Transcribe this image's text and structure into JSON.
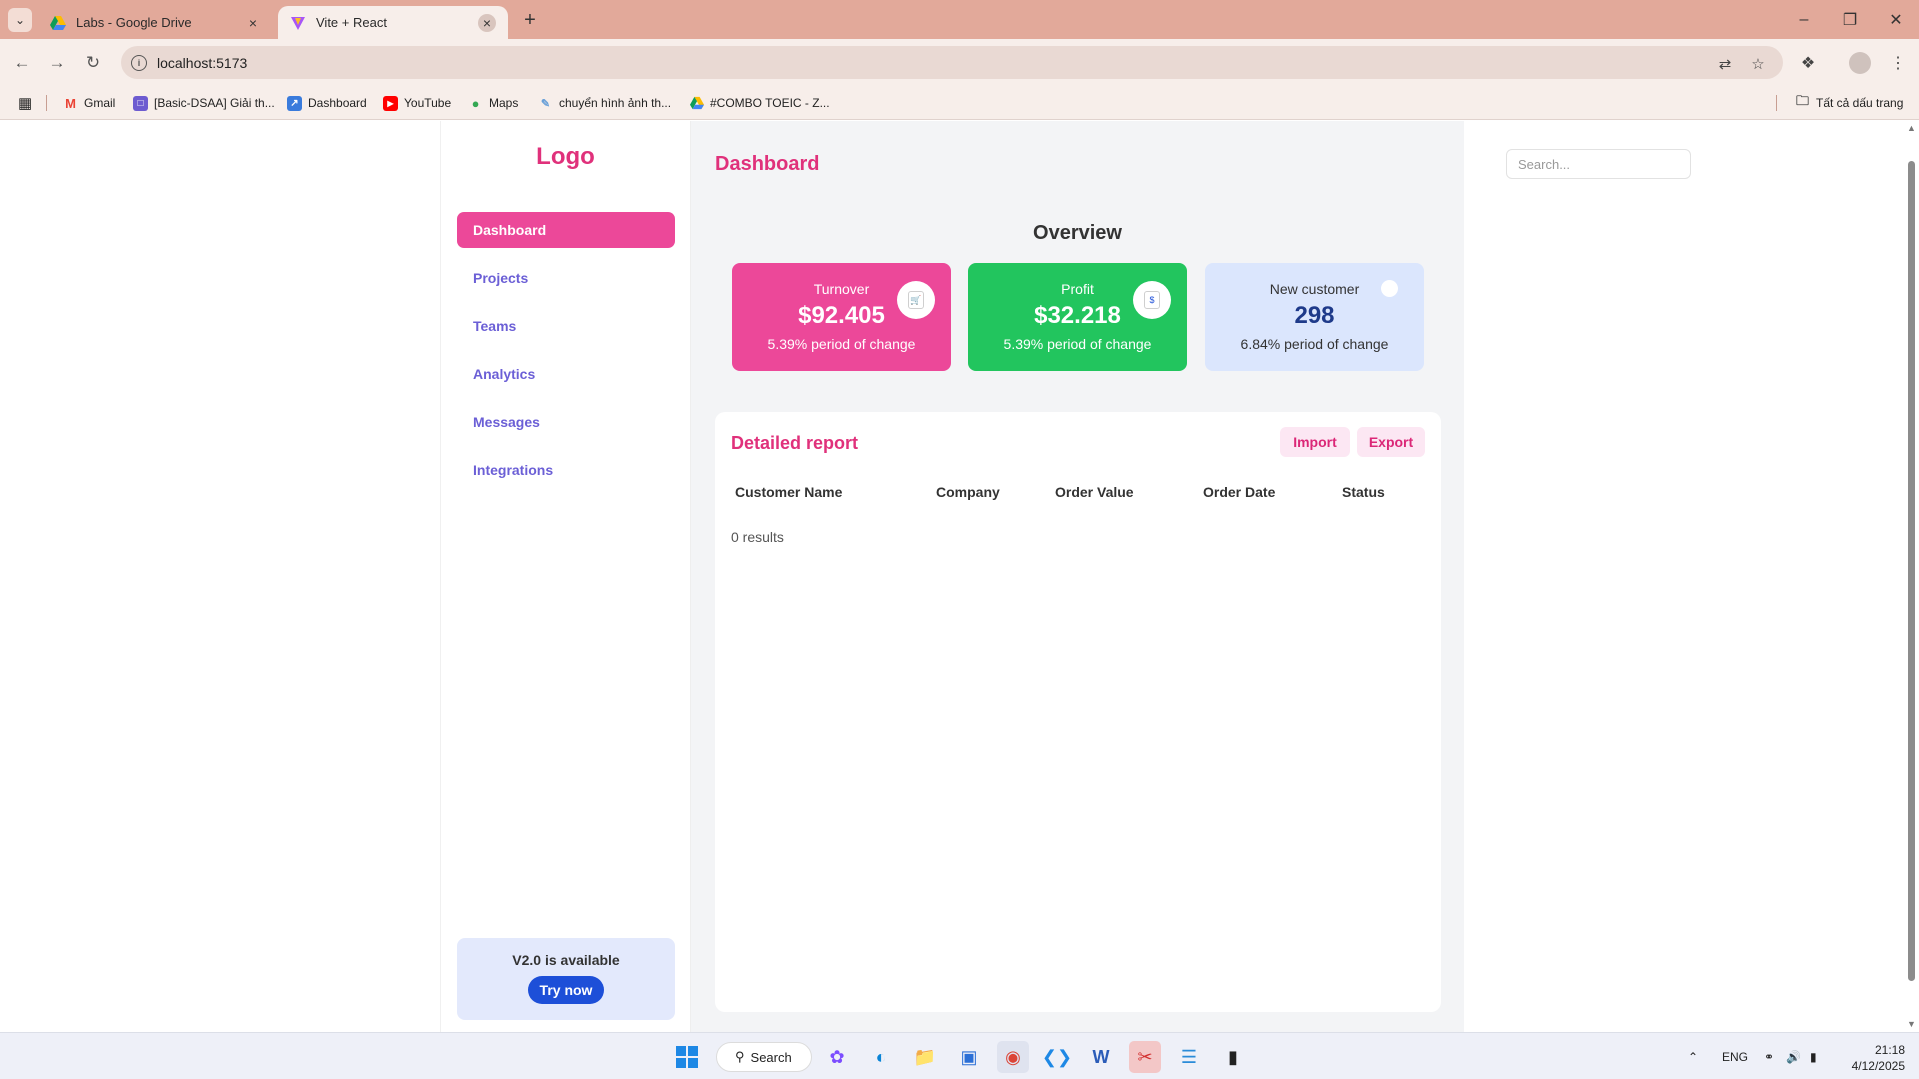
{
  "browser": {
    "tabs": [
      {
        "title": "Labs - Google Drive",
        "active": false
      },
      {
        "title": "Vite + React",
        "active": true
      }
    ],
    "url": "localhost:5173",
    "bookmarks": [
      {
        "label": "Gmail"
      },
      {
        "label": "[Basic-DSAA] Giải th..."
      },
      {
        "label": "Dashboard"
      },
      {
        "label": "YouTube"
      },
      {
        "label": "Maps"
      },
      {
        "label": "chuyển hình ảnh th..."
      },
      {
        "label": "#COMBO TOEIC - Z..."
      }
    ],
    "all_bookmarks_label": "Tất cả dấu trang"
  },
  "sidebar": {
    "logo": "Logo",
    "items": [
      {
        "label": "Dashboard",
        "active": true
      },
      {
        "label": "Projects",
        "active": false
      },
      {
        "label": "Teams",
        "active": false
      },
      {
        "label": "Analytics",
        "active": false
      },
      {
        "label": "Messages",
        "active": false
      },
      {
        "label": "Integrations",
        "active": false
      }
    ],
    "promo": {
      "text": "V2.0 is available",
      "button": "Try now"
    }
  },
  "header": {
    "title": "Dashboard",
    "search_placeholder": "Search..."
  },
  "overview": {
    "title": "Overview",
    "cards": [
      {
        "label": "Turnover",
        "value": "$92.405",
        "change": "5.39% period of change",
        "icon": "cart-icon",
        "color": "#ec4899"
      },
      {
        "label": "Profit",
        "value": "$32.218",
        "change": "5.39% period of change",
        "icon": "dollar-icon",
        "color": "#22c55e"
      },
      {
        "label": "New customer",
        "value": "298",
        "change": "6.84% period of change",
        "icon": "user-icon",
        "color": "#dbe6fd"
      }
    ]
  },
  "report": {
    "title": "Detailed report",
    "import_label": "Import",
    "export_label": "Export",
    "columns": [
      "Customer Name",
      "Company",
      "Order Value",
      "Order Date",
      "Status"
    ],
    "rows": [],
    "results_text": "0 results"
  },
  "taskbar": {
    "search_label": "Search",
    "language": "ENG",
    "time": "21:18",
    "date": "4/12/2025"
  },
  "colors": {
    "accent": "#e0317b",
    "active_nav": "#ec4899",
    "nav_text": "#6b5fd6",
    "primary_button": "#1d4fd8"
  }
}
